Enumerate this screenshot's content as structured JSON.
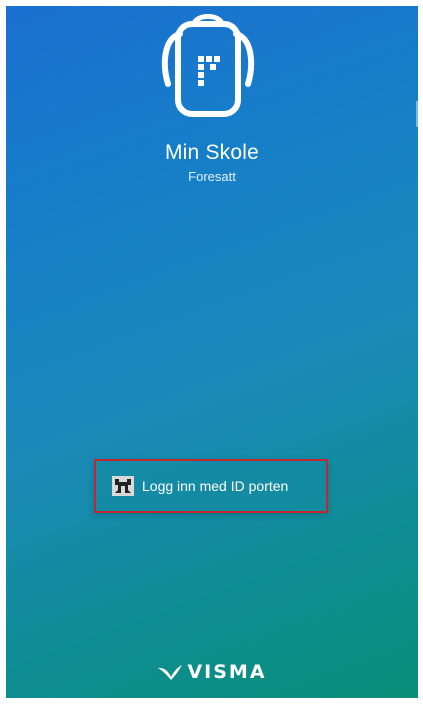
{
  "app": {
    "name": "Min Skole",
    "subtitle": "Foresatt",
    "logo_icon": "backpack-icon"
  },
  "login": {
    "button_label": "Logg inn med ID porten",
    "icon": "idporten-icon",
    "highlight_color": "#c0282d"
  },
  "brand": {
    "name": "VISMA",
    "icon": "visma-swoosh-icon"
  },
  "colors": {
    "gradient_top": "#1a6fd0",
    "gradient_bottom": "#0a8f7a",
    "text": "#ffffff"
  }
}
